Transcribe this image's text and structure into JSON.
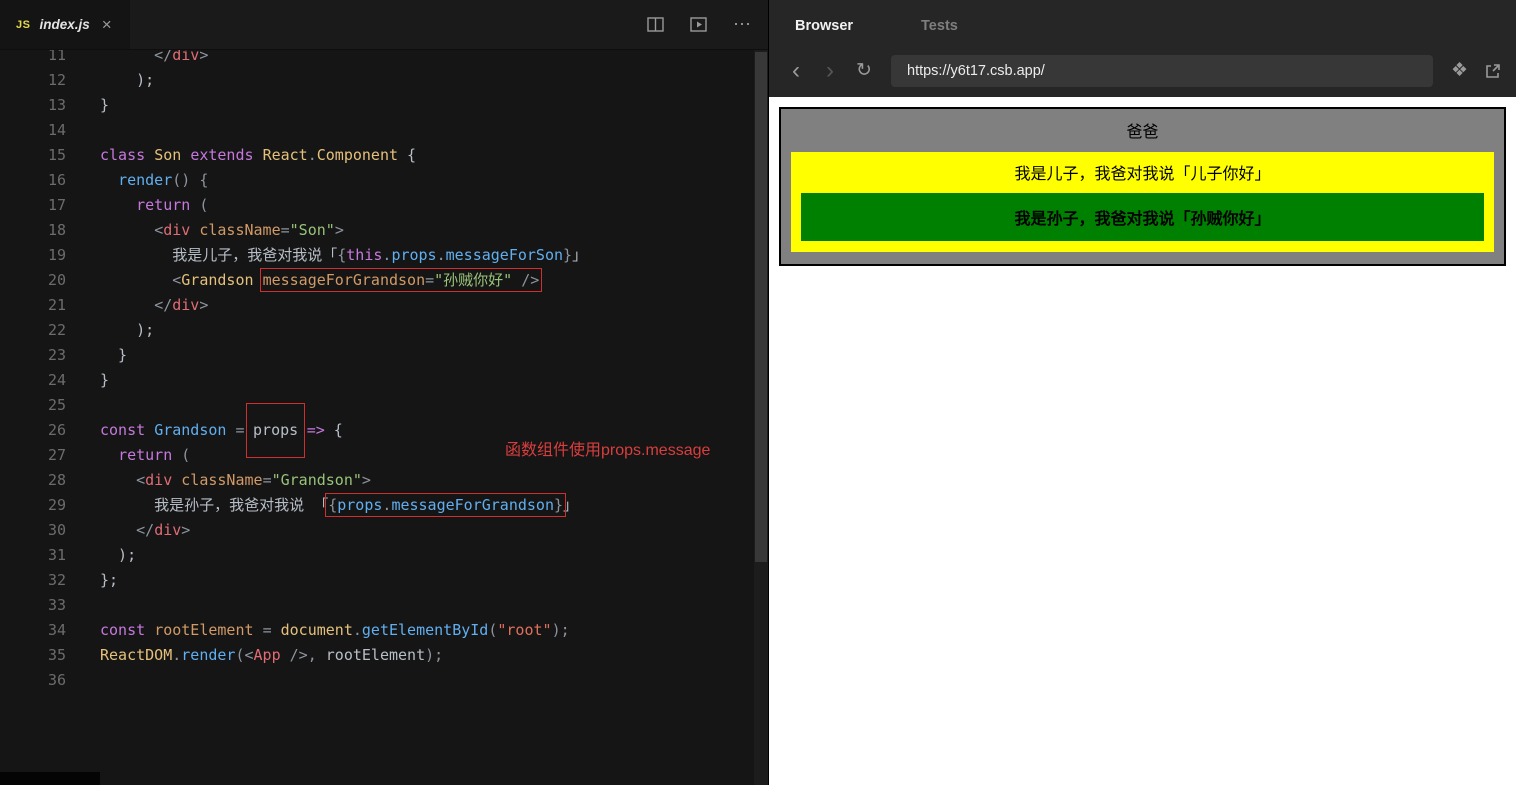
{
  "editor": {
    "tab": {
      "file_icon": "JS",
      "filename": "index.js",
      "close_icon": "×"
    },
    "toolbar": {
      "more_icon": "⋯"
    },
    "annotation": "函数组件使用props.message",
    "lines": [
      {
        "n": 11,
        "t": [
          {
            "c": "pun",
            "s": "      </"
          },
          {
            "c": "tag",
            "s": "div"
          },
          {
            "c": "pun",
            "s": ">"
          }
        ]
      },
      {
        "n": 12,
        "t": [
          {
            "c": "txt",
            "s": "    );"
          }
        ]
      },
      {
        "n": 13,
        "t": [
          {
            "c": "txt",
            "s": "}"
          }
        ]
      },
      {
        "n": 14,
        "t": []
      },
      {
        "n": 15,
        "t": [
          {
            "c": "kw",
            "s": "class"
          },
          {
            "c": "txt",
            "s": " "
          },
          {
            "c": "cls",
            "s": "Son"
          },
          {
            "c": "txt",
            "s": " "
          },
          {
            "c": "kw",
            "s": "extends"
          },
          {
            "c": "txt",
            "s": " "
          },
          {
            "c": "cls",
            "s": "React"
          },
          {
            "c": "pun",
            "s": "."
          },
          {
            "c": "cls",
            "s": "Component"
          },
          {
            "c": "txt",
            "s": " {"
          }
        ]
      },
      {
        "n": 16,
        "t": [
          {
            "c": "txt",
            "s": "  "
          },
          {
            "c": "fn",
            "s": "render"
          },
          {
            "c": "pun",
            "s": "() {"
          }
        ]
      },
      {
        "n": 17,
        "t": [
          {
            "c": "txt",
            "s": "    "
          },
          {
            "c": "kw",
            "s": "return"
          },
          {
            "c": "pun",
            "s": " ("
          }
        ]
      },
      {
        "n": 18,
        "t": [
          {
            "c": "txt",
            "s": "      "
          },
          {
            "c": "pun",
            "s": "<"
          },
          {
            "c": "tag",
            "s": "div"
          },
          {
            "c": "txt",
            "s": " "
          },
          {
            "c": "attr",
            "s": "className"
          },
          {
            "c": "pun",
            "s": "="
          },
          {
            "c": "str",
            "s": "\"Son\""
          },
          {
            "c": "pun",
            "s": ">"
          }
        ]
      },
      {
        "n": 19,
        "t": [
          {
            "c": "txt",
            "s": "        我是儿子，我爸对我说「"
          },
          {
            "c": "pun",
            "s": "{"
          },
          {
            "c": "kw",
            "s": "this"
          },
          {
            "c": "pun",
            "s": "."
          },
          {
            "c": "fn",
            "s": "props"
          },
          {
            "c": "pun",
            "s": "."
          },
          {
            "c": "fn",
            "s": "messageForSon"
          },
          {
            "c": "pun",
            "s": "}"
          },
          {
            "c": "txt",
            "s": "」"
          }
        ]
      },
      {
        "n": 20,
        "t": [
          {
            "c": "txt",
            "s": "        "
          },
          {
            "c": "pun",
            "s": "<"
          },
          {
            "c": "cls",
            "s": "Grandson"
          },
          {
            "c": "txt",
            "s": " "
          },
          {
            "b": "n",
            "tokens": [
              {
                "c": "attr",
                "s": "messageForGrandson"
              },
              {
                "c": "pun",
                "s": "="
              },
              {
                "c": "str",
                "s": "\"孙贼你好\""
              },
              {
                "c": "txt",
                "s": " "
              },
              {
                "c": "pun",
                "s": "/>"
              }
            ]
          }
        ]
      },
      {
        "n": 21,
        "t": [
          {
            "c": "txt",
            "s": "      "
          },
          {
            "c": "pun",
            "s": "</"
          },
          {
            "c": "tag",
            "s": "div"
          },
          {
            "c": "pun",
            "s": ">"
          }
        ]
      },
      {
        "n": 22,
        "t": [
          {
            "c": "txt",
            "s": "    );"
          }
        ]
      },
      {
        "n": 23,
        "t": [
          {
            "c": "txt",
            "s": "  }"
          }
        ]
      },
      {
        "n": 24,
        "t": [
          {
            "c": "txt",
            "s": "}"
          }
        ]
      },
      {
        "n": 25,
        "t": []
      },
      {
        "n": 26,
        "t": [
          {
            "c": "kw",
            "s": "const"
          },
          {
            "c": "txt",
            "s": " "
          },
          {
            "c": "fn",
            "s": "Grandson"
          },
          {
            "c": "txt",
            "s": " "
          },
          {
            "c": "pun",
            "s": "="
          },
          {
            "c": "txt",
            "s": " "
          },
          {
            "b": "t",
            "tokens": [
              {
                "c": "txt",
                "s": "props"
              }
            ]
          },
          {
            "c": "txt",
            "s": " "
          },
          {
            "c": "kw",
            "s": "=>"
          },
          {
            "c": "txt",
            "s": " {"
          }
        ]
      },
      {
        "n": 27,
        "t": [
          {
            "c": "txt",
            "s": "  "
          },
          {
            "c": "kw",
            "s": "return"
          },
          {
            "c": "pun",
            "s": " ("
          }
        ]
      },
      {
        "n": 28,
        "t": [
          {
            "c": "txt",
            "s": "    "
          },
          {
            "c": "pun",
            "s": "<"
          },
          {
            "c": "tag",
            "s": "div"
          },
          {
            "c": "txt",
            "s": " "
          },
          {
            "c": "attr",
            "s": "className"
          },
          {
            "c": "pun",
            "s": "="
          },
          {
            "c": "str",
            "s": "\"Grandson\""
          },
          {
            "c": "pun",
            "s": ">"
          }
        ]
      },
      {
        "n": 29,
        "t": [
          {
            "c": "txt",
            "s": "      我是孙子，我爸对我说 「"
          },
          {
            "b": "n",
            "tokens": [
              {
                "c": "pun",
                "s": "{"
              },
              {
                "c": "fn",
                "s": "props"
              },
              {
                "c": "pun",
                "s": "."
              },
              {
                "c": "fn",
                "s": "messageForGrandson"
              },
              {
                "c": "pun",
                "s": "}"
              }
            ]
          },
          {
            "c": "txt",
            "s": "」"
          }
        ]
      },
      {
        "n": 30,
        "t": [
          {
            "c": "txt",
            "s": "    "
          },
          {
            "c": "pun",
            "s": "</"
          },
          {
            "c": "tag",
            "s": "div"
          },
          {
            "c": "pun",
            "s": ">"
          }
        ]
      },
      {
        "n": 31,
        "t": [
          {
            "c": "txt",
            "s": "  );"
          }
        ]
      },
      {
        "n": 32,
        "t": [
          {
            "c": "txt",
            "s": "};"
          }
        ]
      },
      {
        "n": 33,
        "t": []
      },
      {
        "n": 34,
        "t": [
          {
            "c": "kw",
            "s": "const"
          },
          {
            "c": "txt",
            "s": " "
          },
          {
            "c": "attr",
            "s": "rootElement"
          },
          {
            "c": "txt",
            "s": " "
          },
          {
            "c": "pun",
            "s": "="
          },
          {
            "c": "txt",
            "s": " "
          },
          {
            "c": "cls",
            "s": "document"
          },
          {
            "c": "pun",
            "s": "."
          },
          {
            "c": "fn",
            "s": "getElementById"
          },
          {
            "c": "pun",
            "s": "("
          },
          {
            "c": "strr",
            "s": "\"root\""
          },
          {
            "c": "pun",
            "s": ");"
          }
        ]
      },
      {
        "n": 35,
        "t": [
          {
            "c": "cls",
            "s": "ReactDOM"
          },
          {
            "c": "pun",
            "s": "."
          },
          {
            "c": "fn",
            "s": "render"
          },
          {
            "c": "pun",
            "s": "(<"
          },
          {
            "c": "tag",
            "s": "App"
          },
          {
            "c": "txt",
            "s": " "
          },
          {
            "c": "pun",
            "s": "/>"
          },
          {
            "c": "pun",
            "s": ", "
          },
          {
            "c": "txt",
            "s": "rootElement"
          },
          {
            "c": "pun",
            "s": ");"
          }
        ]
      },
      {
        "n": 36,
        "t": []
      }
    ]
  },
  "browser": {
    "tabs": {
      "browser": "Browser",
      "tests": "Tests"
    },
    "nav": {
      "back_icon": "‹",
      "forward_icon": "›",
      "refresh_icon": "↻",
      "responsive_icon": "❖",
      "url": "https://y6t17.csb.app/"
    },
    "preview": {
      "app_title": "爸爸",
      "son_text": "我是儿子，我爸对我说「儿子你好」",
      "grandson_text": "我是孙子，我爸对我说「孙贼你好」",
      "colors": {
        "app_bg": "#808080",
        "app_border": "#000000",
        "son_bg": "#ffff00",
        "grandson_bg": "#008000",
        "annotation_red": "#d83e3e"
      }
    }
  }
}
